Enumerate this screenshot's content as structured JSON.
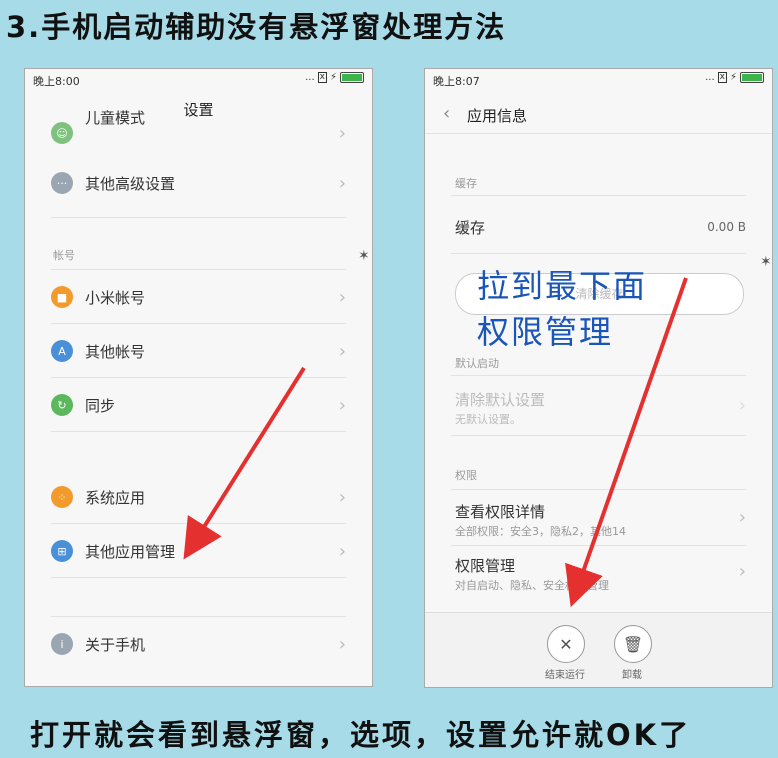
{
  "title": "3.手机启动辅助没有悬浮窗处理方法",
  "caption": "打开就会看到悬浮窗，选项，设置允许就OK了",
  "phone1": {
    "time": "晚上8:00",
    "signal": "...",
    "sim": "x",
    "header": "设置",
    "items": [
      {
        "label": "儿童模式",
        "icon": "child-mode-icon",
        "color": "#7ec27e"
      },
      {
        "label": "其他高级设置",
        "icon": "more-dots-icon",
        "color": "#9aa7b3"
      },
      {
        "label": "小米帐号",
        "icon": "mi-account-icon",
        "color": "#f39a2c"
      },
      {
        "label": "其他帐号",
        "icon": "account-icon",
        "color": "#4a90d9"
      },
      {
        "label": "同步",
        "icon": "sync-icon",
        "color": "#5cb85c"
      },
      {
        "label": "系统应用",
        "icon": "system-apps-icon",
        "color": "#f39a2c"
      },
      {
        "label": "其他应用管理",
        "icon": "apps-manage-icon",
        "color": "#4a90d9"
      },
      {
        "label": "关于手机",
        "icon": "info-icon",
        "color": "#9aa7b3"
      }
    ],
    "section_account": "帐号"
  },
  "phone2": {
    "time": "晚上8:07",
    "signal": "...",
    "sim": "x",
    "header": "应用信息",
    "section_cache": "缓存",
    "cache_label": "缓存",
    "cache_value": "0.00 B",
    "clear_cache": "清除缓存",
    "overlay_line1": "拉到最下面",
    "overlay_line2": "权限管理",
    "section_default": "默认启动",
    "clear_default": "清除默认设置",
    "clear_default_sub": "无默认设置。",
    "section_perm": "权限",
    "view_perm": "查看权限详情",
    "view_perm_sub": "全部权限：安全3，隐私2，其他14",
    "perm_manage": "权限管理",
    "perm_manage_sub": "对自启动、隐私、安全权限管理",
    "btn_stop": "结束运行",
    "btn_uninstall": "卸载"
  },
  "colors": {
    "arrow": "#e53030",
    "overlay_text": "#1a55b8",
    "background": "#a8dbe8"
  }
}
